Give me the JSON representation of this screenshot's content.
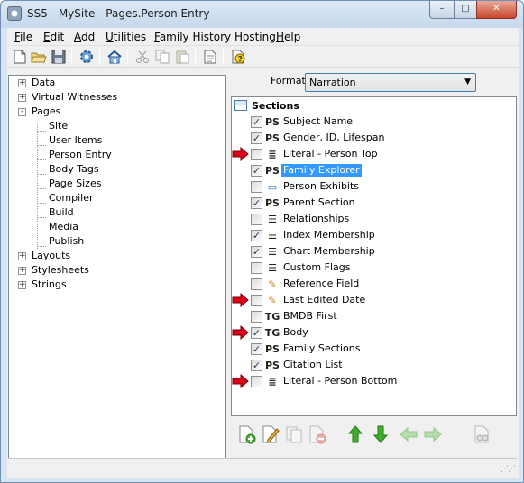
{
  "window": {
    "title": "SS5 - MySite - Pages.Person Entry",
    "minimize_label": "–",
    "maximize_label": "□",
    "close_label": "✕"
  },
  "menu": [
    {
      "underlined": "F",
      "rest": "ile"
    },
    {
      "underlined": "E",
      "rest": "dit"
    },
    {
      "underlined": "A",
      "rest": "dd"
    },
    {
      "underlined": "U",
      "rest": "tilities"
    },
    {
      "underlined": "F",
      "rest": "amily History Hosting"
    },
    {
      "underlined": "H",
      "rest": "elp"
    }
  ],
  "toolbar_icons": [
    "new-file-icon",
    "open-folder-icon",
    "save-icon",
    "settings-gear-icon",
    "home-icon",
    "cut-icon",
    "copy-icon",
    "paste-icon",
    "page-icon",
    "help-icon"
  ],
  "tree": {
    "nodes": [
      {
        "label": "Data",
        "expander": "+"
      },
      {
        "label": "Virtual Witnesses",
        "expander": "+"
      },
      {
        "label": "Pages",
        "expander": "-"
      },
      {
        "label": "Site"
      },
      {
        "label": "User Items"
      },
      {
        "label": "Person Entry"
      },
      {
        "label": "Body Tags"
      },
      {
        "label": "Page Sizes"
      },
      {
        "label": "Compiler"
      },
      {
        "label": "Build"
      },
      {
        "label": "Media"
      },
      {
        "label": "Publish"
      },
      {
        "label": "Layouts",
        "expander": "+"
      },
      {
        "label": "Stylesheets",
        "expander": "+"
      },
      {
        "label": "Strings",
        "expander": "+"
      }
    ]
  },
  "format": {
    "label": "Format",
    "value": "Narration",
    "arrow": "▼"
  },
  "sections": {
    "header": "Sections",
    "items": [
      {
        "label": "Subject Name",
        "checked": "✓",
        "icon": "PS"
      },
      {
        "label": "Gender, ID, Lifespan",
        "checked": "✓",
        "icon": "PS"
      },
      {
        "label": "Literal - Person Top",
        "checked": "",
        "icon": "≣"
      },
      {
        "label": "Family Explorer",
        "checked": "✓",
        "icon": "PS"
      },
      {
        "label": "Person Exhibits",
        "checked": "",
        "icon": "▭"
      },
      {
        "label": "Parent Section",
        "checked": "✓",
        "icon": "PS"
      },
      {
        "label": "Relationships",
        "checked": "",
        "icon": "☰"
      },
      {
        "label": "Index Membership",
        "checked": "✓",
        "icon": "☰"
      },
      {
        "label": "Chart Membership",
        "checked": "✓",
        "icon": "☰"
      },
      {
        "label": "Custom Flags",
        "checked": "",
        "icon": "☰"
      },
      {
        "label": "Reference Field",
        "checked": "",
        "icon": "✎"
      },
      {
        "label": "Last Edited Date",
        "checked": "",
        "icon": "✎"
      },
      {
        "label": "BMDB First",
        "checked": "",
        "icon": "TG"
      },
      {
        "label": "Body",
        "checked": "✓",
        "icon": "TG"
      },
      {
        "label": "Family Sections",
        "checked": "✓",
        "icon": "PS"
      },
      {
        "label": "Citation List",
        "checked": "✓",
        "icon": "PS"
      },
      {
        "label": "Literal - Person Bottom",
        "checked": "",
        "icon": "≣"
      }
    ]
  },
  "accent_colors": {
    "selection": "#3399ff",
    "arrow": "#d9001b",
    "green_arrow": "#3fae2a"
  }
}
